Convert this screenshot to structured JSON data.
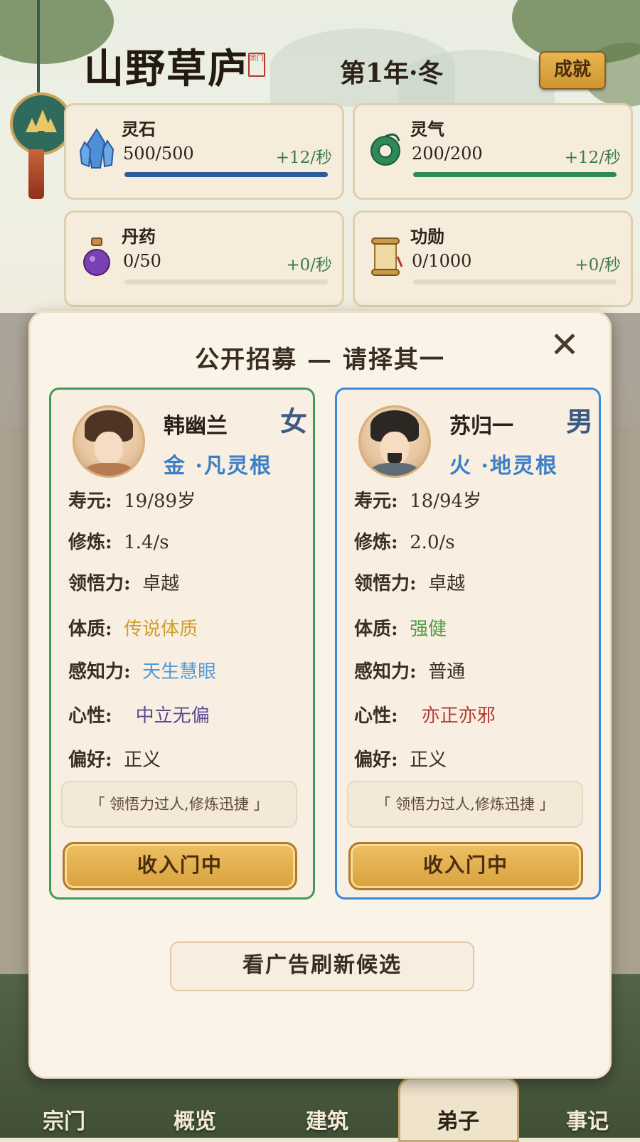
{
  "header": {
    "title": "山野草庐",
    "seal_text": "宗门",
    "date": "第1年·冬",
    "achievements_label": "成就"
  },
  "resources": [
    {
      "name": "灵石",
      "value": "500/500",
      "rate": "+12/秒",
      "fill": 1.0,
      "bar_color": "#2c5c9a",
      "icon": "crystal-icon"
    },
    {
      "name": "灵气",
      "value": "200/200",
      "rate": "+12/秒",
      "fill": 1.0,
      "bar_color": "#2f8a58",
      "icon": "jade-icon"
    },
    {
      "name": "丹药",
      "value": "0/50",
      "rate": "+0/秒",
      "fill": 0.0,
      "bar_color": "#8a5aa8",
      "icon": "potion-icon"
    },
    {
      "name": "功勋",
      "value": "0/1000",
      "rate": "+0/秒",
      "fill": 0.0,
      "bar_color": "#b88a3a",
      "icon": "scroll-icon"
    }
  ],
  "modal": {
    "title": "公开招募 — 请择其一",
    "close_label": "✕",
    "refresh_label": "看广告刷新候选",
    "candidates": [
      {
        "name": "韩幽兰",
        "gender": "女",
        "root": "金 ·凡灵根",
        "lifespan_label": "寿元:",
        "lifespan": "19/89岁",
        "cultivation_label": "修炼:",
        "cultivation": "1.4/s",
        "comprehension_label": "领悟力:",
        "comprehension": "卓越",
        "physique_label": "体质:",
        "physique": "传说体质",
        "physique_color": "#cf9e2c",
        "perception_label": "感知力:",
        "perception": "天生慧眼",
        "perception_color": "#4f9ad8",
        "temperament_label": "心性:",
        "temperament": "中立无偏",
        "temperament_color": "#5c4a92",
        "preference_label": "偏好:",
        "preference": "正义",
        "quote": "「 领悟力过人,修炼迅捷 」",
        "recruit_label": "收入门中"
      },
      {
        "name": "苏归一",
        "gender": "男",
        "root": "火 ·地灵根",
        "lifespan_label": "寿元:",
        "lifespan": "18/94岁",
        "cultivation_label": "修炼:",
        "cultivation": "2.0/s",
        "comprehension_label": "领悟力:",
        "comprehension": "卓越",
        "physique_label": "体质:",
        "physique": "强健",
        "physique_color": "#4f9a44",
        "perception_label": "感知力:",
        "perception": "普通",
        "perception_color": "#3a2f24",
        "temperament_label": "心性:",
        "temperament": "亦正亦邪",
        "temperament_color": "#b23a30",
        "preference_label": "偏好:",
        "preference": "正义",
        "quote": "「 领悟力过人,修炼迅捷 」",
        "recruit_label": "收入门中"
      }
    ]
  },
  "nav": {
    "items": [
      "宗门",
      "概览",
      "建筑",
      "弟子",
      "事记"
    ],
    "active": "弟子"
  }
}
